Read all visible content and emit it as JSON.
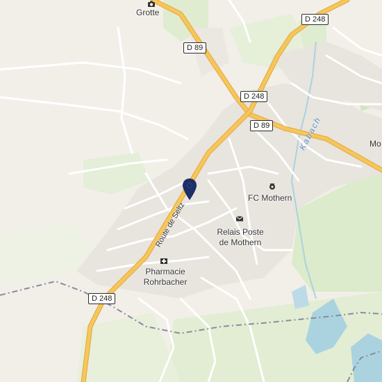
{
  "map": {
    "colors": {
      "background": "#f2efe9",
      "green": "#dfeccf",
      "dark_green": "#cfe3bd",
      "water": "#aad3df",
      "road_major": "#f6c65b",
      "road_major_casing": "#e2a83a",
      "road_minor": "#ffffff",
      "road_minor_casing": "#d9d4cb",
      "urban": "#e8e4de",
      "boundary": "#8a8aa0",
      "pin": "#1c2f66"
    },
    "road_shields": [
      {
        "id": "d248-top",
        "label": "D 248"
      },
      {
        "id": "d89-top",
        "label": "D 89"
      },
      {
        "id": "d248-center",
        "label": "D 248"
      },
      {
        "id": "d89-center",
        "label": "D 89"
      },
      {
        "id": "d248-bottom",
        "label": "D 248"
      }
    ],
    "pois": [
      {
        "id": "grotte",
        "label": "Grotte",
        "icon": "camera-icon"
      },
      {
        "id": "fc-mothern",
        "label": "FC Mothern",
        "icon": "football-icon"
      },
      {
        "id": "relais-poste",
        "label": "Relais Poste de Mothern",
        "line1": "Relais Poste",
        "line2": "de Mothern",
        "icon": "mail-icon"
      },
      {
        "id": "pharmacie",
        "label": "Pharmacie Rohrbacher",
        "line1": "Pharmacie",
        "line2": "Rohrbacher",
        "icon": "pharmacy-icon"
      }
    ],
    "water_label": "Kabach",
    "street_label": "Route de Seltz",
    "edge_label": "Mo",
    "marker": {
      "icon": "location-pin-icon"
    }
  }
}
